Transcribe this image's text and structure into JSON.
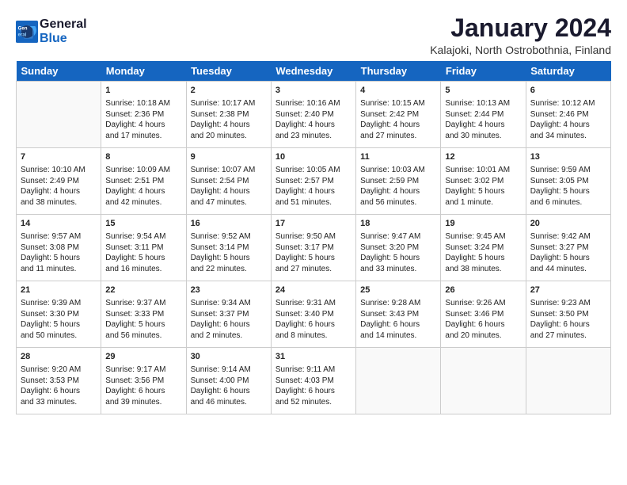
{
  "header": {
    "logo_line1": "General",
    "logo_line2": "Blue",
    "title": "January 2024",
    "subtitle": "Kalajoki, North Ostrobothnia, Finland"
  },
  "days_of_week": [
    "Sunday",
    "Monday",
    "Tuesday",
    "Wednesday",
    "Thursday",
    "Friday",
    "Saturday"
  ],
  "weeks": [
    [
      {
        "date": "",
        "text": ""
      },
      {
        "date": "1",
        "text": "Sunrise: 10:18 AM\nSunset: 2:36 PM\nDaylight: 4 hours\nand 17 minutes."
      },
      {
        "date": "2",
        "text": "Sunrise: 10:17 AM\nSunset: 2:38 PM\nDaylight: 4 hours\nand 20 minutes."
      },
      {
        "date": "3",
        "text": "Sunrise: 10:16 AM\nSunset: 2:40 PM\nDaylight: 4 hours\nand 23 minutes."
      },
      {
        "date": "4",
        "text": "Sunrise: 10:15 AM\nSunset: 2:42 PM\nDaylight: 4 hours\nand 27 minutes."
      },
      {
        "date": "5",
        "text": "Sunrise: 10:13 AM\nSunset: 2:44 PM\nDaylight: 4 hours\nand 30 minutes."
      },
      {
        "date": "6",
        "text": "Sunrise: 10:12 AM\nSunset: 2:46 PM\nDaylight: 4 hours\nand 34 minutes."
      }
    ],
    [
      {
        "date": "7",
        "text": "Sunrise: 10:10 AM\nSunset: 2:49 PM\nDaylight: 4 hours\nand 38 minutes."
      },
      {
        "date": "8",
        "text": "Sunrise: 10:09 AM\nSunset: 2:51 PM\nDaylight: 4 hours\nand 42 minutes."
      },
      {
        "date": "9",
        "text": "Sunrise: 10:07 AM\nSunset: 2:54 PM\nDaylight: 4 hours\nand 47 minutes."
      },
      {
        "date": "10",
        "text": "Sunrise: 10:05 AM\nSunset: 2:57 PM\nDaylight: 4 hours\nand 51 minutes."
      },
      {
        "date": "11",
        "text": "Sunrise: 10:03 AM\nSunset: 2:59 PM\nDaylight: 4 hours\nand 56 minutes."
      },
      {
        "date": "12",
        "text": "Sunrise: 10:01 AM\nSunset: 3:02 PM\nDaylight: 5 hours\nand 1 minute."
      },
      {
        "date": "13",
        "text": "Sunrise: 9:59 AM\nSunset: 3:05 PM\nDaylight: 5 hours\nand 6 minutes."
      }
    ],
    [
      {
        "date": "14",
        "text": "Sunrise: 9:57 AM\nSunset: 3:08 PM\nDaylight: 5 hours\nand 11 minutes."
      },
      {
        "date": "15",
        "text": "Sunrise: 9:54 AM\nSunset: 3:11 PM\nDaylight: 5 hours\nand 16 minutes."
      },
      {
        "date": "16",
        "text": "Sunrise: 9:52 AM\nSunset: 3:14 PM\nDaylight: 5 hours\nand 22 minutes."
      },
      {
        "date": "17",
        "text": "Sunrise: 9:50 AM\nSunset: 3:17 PM\nDaylight: 5 hours\nand 27 minutes."
      },
      {
        "date": "18",
        "text": "Sunrise: 9:47 AM\nSunset: 3:20 PM\nDaylight: 5 hours\nand 33 minutes."
      },
      {
        "date": "19",
        "text": "Sunrise: 9:45 AM\nSunset: 3:24 PM\nDaylight: 5 hours\nand 38 minutes."
      },
      {
        "date": "20",
        "text": "Sunrise: 9:42 AM\nSunset: 3:27 PM\nDaylight: 5 hours\nand 44 minutes."
      }
    ],
    [
      {
        "date": "21",
        "text": "Sunrise: 9:39 AM\nSunset: 3:30 PM\nDaylight: 5 hours\nand 50 minutes."
      },
      {
        "date": "22",
        "text": "Sunrise: 9:37 AM\nSunset: 3:33 PM\nDaylight: 5 hours\nand 56 minutes."
      },
      {
        "date": "23",
        "text": "Sunrise: 9:34 AM\nSunset: 3:37 PM\nDaylight: 6 hours\nand 2 minutes."
      },
      {
        "date": "24",
        "text": "Sunrise: 9:31 AM\nSunset: 3:40 PM\nDaylight: 6 hours\nand 8 minutes."
      },
      {
        "date": "25",
        "text": "Sunrise: 9:28 AM\nSunset: 3:43 PM\nDaylight: 6 hours\nand 14 minutes."
      },
      {
        "date": "26",
        "text": "Sunrise: 9:26 AM\nSunset: 3:46 PM\nDaylight: 6 hours\nand 20 minutes."
      },
      {
        "date": "27",
        "text": "Sunrise: 9:23 AM\nSunset: 3:50 PM\nDaylight: 6 hours\nand 27 minutes."
      }
    ],
    [
      {
        "date": "28",
        "text": "Sunrise: 9:20 AM\nSunset: 3:53 PM\nDaylight: 6 hours\nand 33 minutes."
      },
      {
        "date": "29",
        "text": "Sunrise: 9:17 AM\nSunset: 3:56 PM\nDaylight: 6 hours\nand 39 minutes."
      },
      {
        "date": "30",
        "text": "Sunrise: 9:14 AM\nSunset: 4:00 PM\nDaylight: 6 hours\nand 46 minutes."
      },
      {
        "date": "31",
        "text": "Sunrise: 9:11 AM\nSunset: 4:03 PM\nDaylight: 6 hours\nand 52 minutes."
      },
      {
        "date": "",
        "text": ""
      },
      {
        "date": "",
        "text": ""
      },
      {
        "date": "",
        "text": ""
      }
    ]
  ]
}
